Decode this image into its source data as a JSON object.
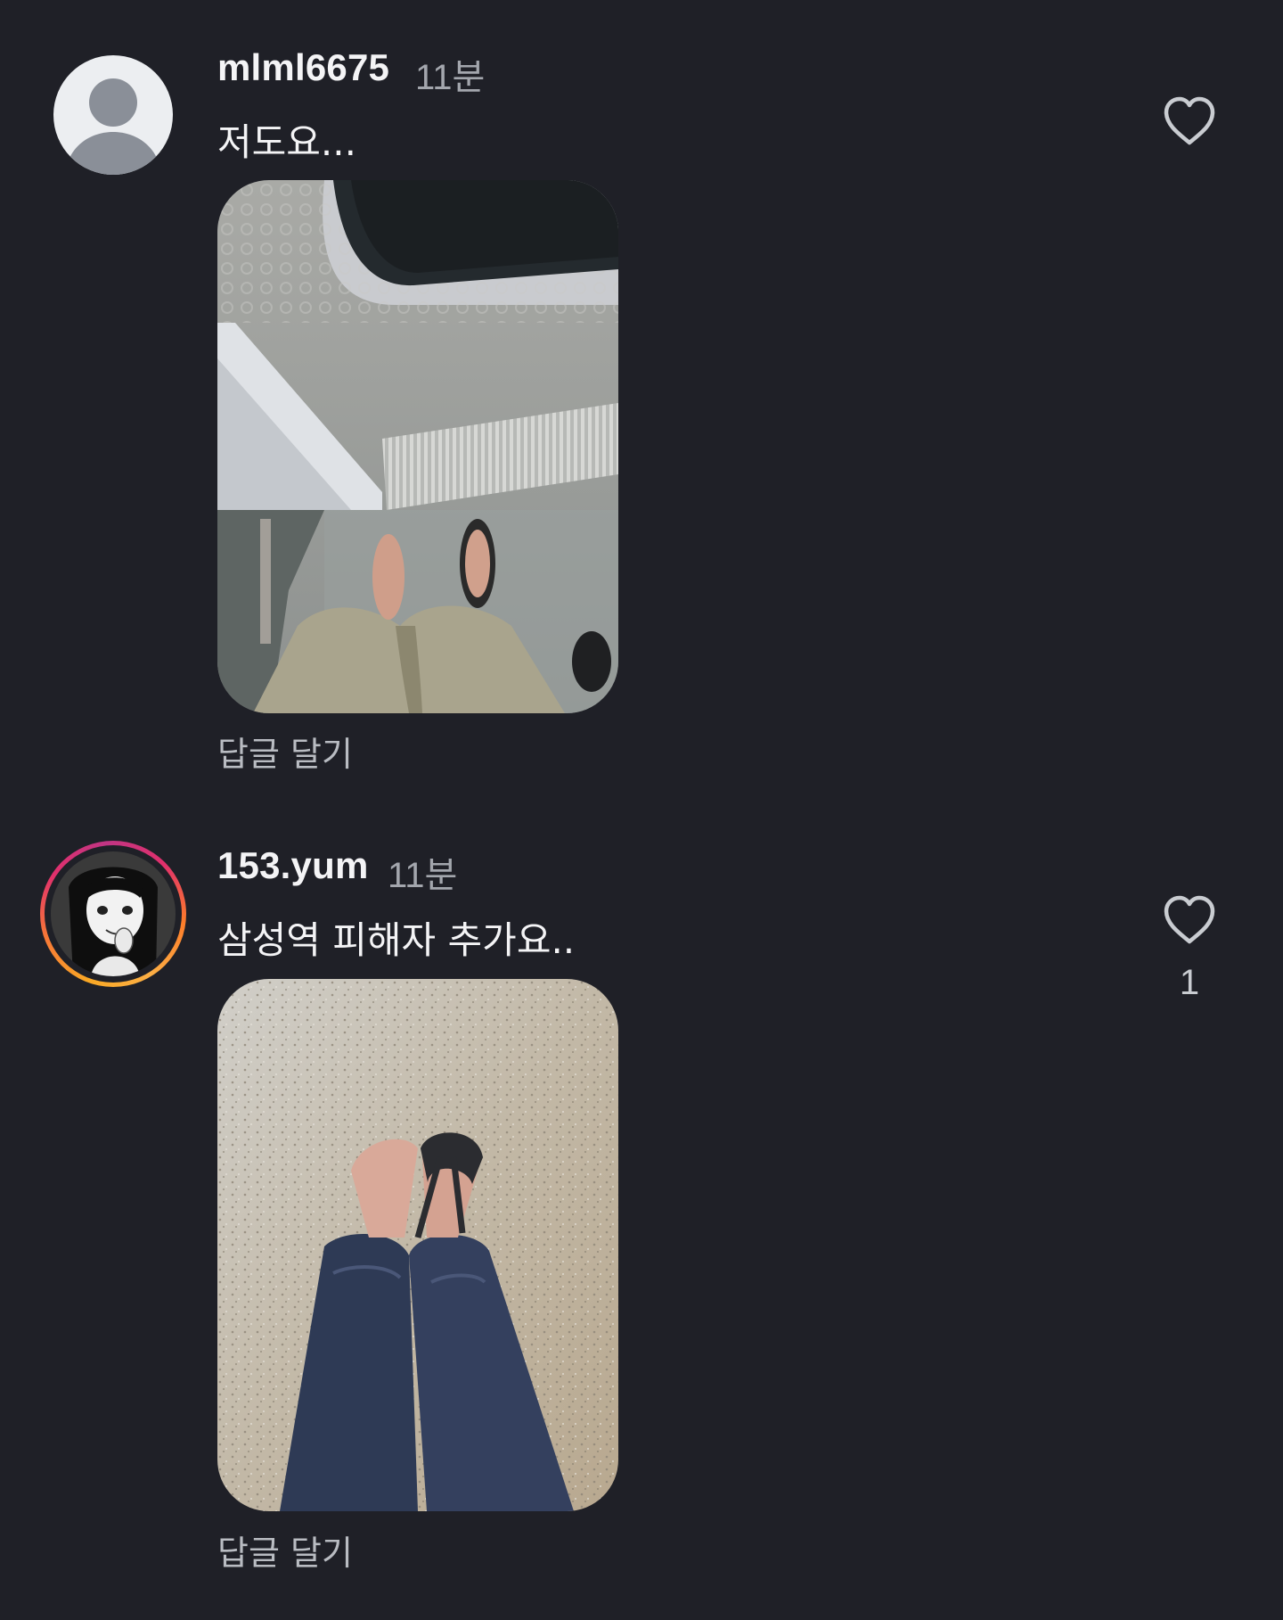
{
  "comments": [
    {
      "username": "mlml6675",
      "time": "11분",
      "text": "저도요...",
      "reply_label": "답글 달기",
      "avatar": "default-person-icon",
      "like_icon": "heart-outline-icon",
      "like_count": ""
    },
    {
      "username": "153.yum",
      "time": "11분",
      "text": "삼성역 피해자 추가요..",
      "reply_label": "답글 달기",
      "avatar": "illustrated-girl-avatar-with-story-ring",
      "like_icon": "heart-outline-icon",
      "like_count": "1"
    }
  ],
  "colors": {
    "background": "#1f2027",
    "text_primary": "#f4f4f6",
    "text_secondary": "#a3a6ad"
  }
}
